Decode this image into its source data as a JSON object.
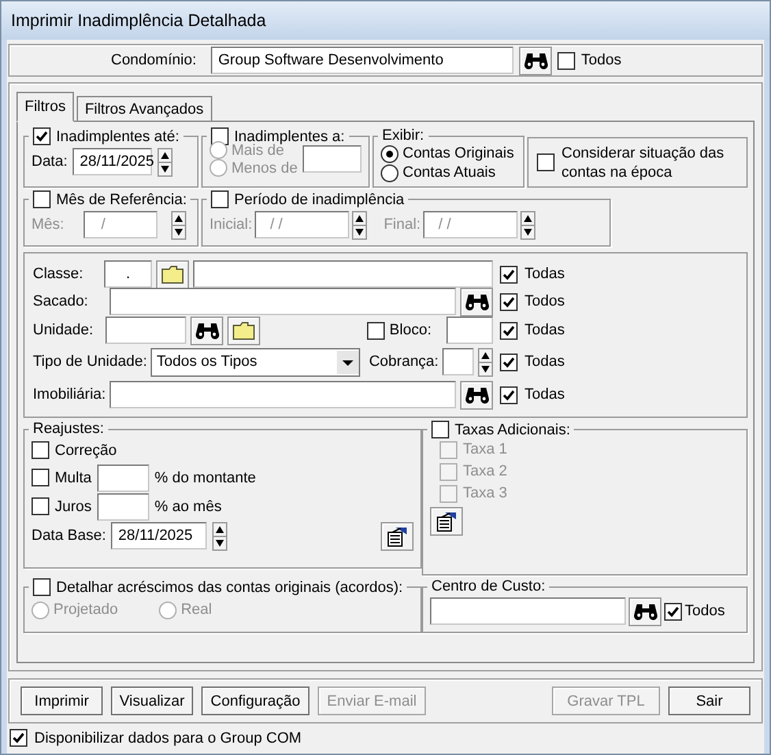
{
  "window": {
    "title": "Imprimir Inadimplência Detalhada"
  },
  "condominio": {
    "label": "Condomínio:",
    "value": "Group Software Desenvolvimento",
    "todos": {
      "label": "Todos",
      "checked": false
    }
  },
  "tabs": [
    {
      "label": "Filtros",
      "selected": true
    },
    {
      "label": "Filtros Avançados",
      "selected": false
    }
  ],
  "inadimplentes_ate": {
    "label": "Inadimplentes até:",
    "checked": true,
    "data_label": "Data:",
    "data_value": "28/11/2025"
  },
  "inadimplentes_a": {
    "label": "Inadimplentes a:",
    "checked": false,
    "disabled": true,
    "options": [
      {
        "label": "Mais de",
        "selected": false
      },
      {
        "label": "Menos de",
        "selected": false
      }
    ]
  },
  "exibir": {
    "label": "Exibir:",
    "options": [
      {
        "label": "Contas Originais",
        "selected": true
      },
      {
        "label": "Contas Atuais",
        "selected": false
      }
    ]
  },
  "considerar": {
    "label": "Considerar situação das contas na época",
    "checked": false
  },
  "mes_referencia": {
    "label": "Mês de Referência:",
    "checked": false,
    "disabled": true,
    "mes_label": "Mês:",
    "mes_value": "/"
  },
  "periodo": {
    "label": "Período de inadimplência",
    "checked": false,
    "disabled": true,
    "inicial_label": "Inicial:",
    "inicial_value": "/ /",
    "final_label": "Final:",
    "final_value": "/ /"
  },
  "filtros": {
    "classe": {
      "label": "Classe:",
      "value": ".",
      "todas": {
        "label": "Todas",
        "checked": true
      }
    },
    "sacado": {
      "label": "Sacado:",
      "todas": {
        "label": "Todos",
        "checked": true
      }
    },
    "unidade": {
      "label": "Unidade:",
      "bloco": {
        "label": "Bloco:",
        "checked": false
      },
      "todas": {
        "label": "Todas",
        "checked": true
      }
    },
    "tipo_unidade": {
      "label": "Tipo de Unidade:",
      "value": "Todos os Tipos",
      "cobranca_label": "Cobrança:",
      "todas": {
        "label": "Todas",
        "checked": true
      }
    },
    "imobiliaria": {
      "label": "Imobiliária:",
      "todas": {
        "label": "Todas",
        "checked": true
      }
    }
  },
  "reajustes": {
    "label": "Reajustes:",
    "correcao": {
      "label": "Correção",
      "checked": false
    },
    "multa": {
      "label": "Multa",
      "checked": false,
      "suffix": "% do montante"
    },
    "juros": {
      "label": "Juros",
      "checked": false,
      "suffix": "% ao mês"
    },
    "data_base_label": "Data Base:",
    "data_base_value": "28/11/2025"
  },
  "taxas": {
    "label": "Taxas Adicionais:",
    "checked": false,
    "disabled": true,
    "items": [
      {
        "label": "Taxa 1",
        "checked": false
      },
      {
        "label": "Taxa 2",
        "checked": false
      },
      {
        "label": "Taxa 3",
        "checked": false
      }
    ]
  },
  "detalhar": {
    "label": "Detalhar acréscimos das contas originais (acordos):",
    "checked": false,
    "disabled": true,
    "options": [
      {
        "label": "Projetado",
        "selected": false
      },
      {
        "label": "Real",
        "selected": false
      }
    ]
  },
  "centro_custo": {
    "label": "Centro de Custo:",
    "todos": {
      "label": "Todos",
      "checked": true
    }
  },
  "buttons": [
    {
      "label": "Imprimir",
      "disabled": false
    },
    {
      "label": "Visualizar",
      "disabled": false
    },
    {
      "label": "Configuração",
      "disabled": false
    },
    {
      "label": "Enviar E-mail",
      "disabled": true
    },
    {
      "label": "Gravar TPL",
      "disabled": true
    },
    {
      "label": "Sair",
      "disabled": false
    }
  ],
  "group_com": {
    "label": "Disponibilizar dados para o Group COM",
    "checked": true
  }
}
